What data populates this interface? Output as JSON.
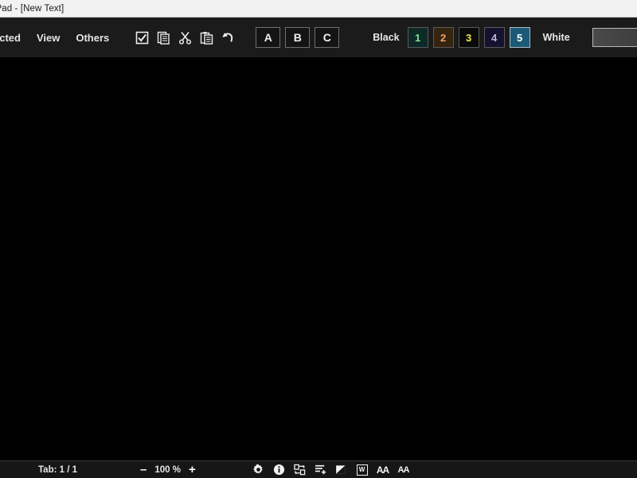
{
  "window": {
    "title": "ePad - [New Text]"
  },
  "menu": {
    "items": [
      {
        "label": "ected",
        "name": "menu-selected"
      },
      {
        "label": "View",
        "name": "menu-view"
      },
      {
        "label": "Others",
        "name": "menu-others"
      }
    ]
  },
  "toolbar": {
    "edit_icons": [
      {
        "name": "select-all-icon",
        "title": "Select All"
      },
      {
        "name": "copy-icon",
        "title": "Copy"
      },
      {
        "name": "cut-icon",
        "title": "Cut"
      },
      {
        "name": "paste-icon",
        "title": "Paste"
      },
      {
        "name": "undo-icon",
        "title": "Undo"
      }
    ],
    "style_buttons": [
      {
        "label": "A",
        "name": "style-button-a"
      },
      {
        "label": "B",
        "name": "style-button-b"
      },
      {
        "label": "C",
        "name": "style-button-c"
      }
    ],
    "palette": {
      "left_label": "Black",
      "right_label": "White",
      "swatches": [
        {
          "label": "1",
          "bg": "#0d2a26",
          "fg": "#7fe39a",
          "selected": false
        },
        {
          "label": "2",
          "bg": "#35250f",
          "fg": "#f0a265",
          "selected": false
        },
        {
          "label": "3",
          "bg": "#0a0a0a",
          "fg": "#f2e34b",
          "selected": false
        },
        {
          "label": "4",
          "bg": "#15122f",
          "fg": "#b9b4e8",
          "selected": false
        },
        {
          "label": "5",
          "bg": "#1b5a77",
          "fg": "#ffffff",
          "selected": true
        }
      ],
      "gradient_start": "#4a4a4a",
      "gradient_end": "#333333"
    }
  },
  "canvas": {
    "background": "#000000",
    "content": ""
  },
  "statusbar": {
    "tab_label": "Tab: 1 / 1",
    "zoom_out_label": "–",
    "zoom_value": "100 %",
    "zoom_in_label": "+",
    "icons": [
      {
        "name": "gear-icon",
        "title": "Settings"
      },
      {
        "name": "info-icon",
        "title": "Information"
      },
      {
        "name": "sync-icon",
        "title": "Sync"
      },
      {
        "name": "list-add-icon",
        "title": "Add to list"
      },
      {
        "name": "contrast-icon",
        "title": "Contrast"
      },
      {
        "name": "word-wrap-icon",
        "label": "W",
        "title": "Word wrap"
      },
      {
        "name": "font-increase-icon",
        "label": "AA",
        "title": "Increase font size"
      },
      {
        "name": "font-decrease-icon",
        "label": "AA",
        "title": "Decrease font size"
      }
    ]
  }
}
